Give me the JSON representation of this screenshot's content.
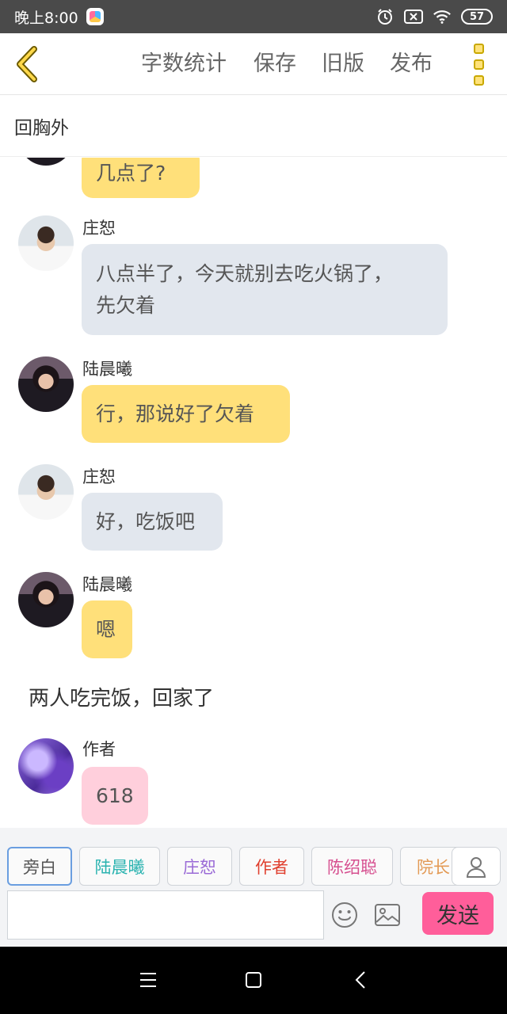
{
  "status_bar": {
    "time": "晚上8:00",
    "battery": "57"
  },
  "toolbar": {
    "word_count": "字数统计",
    "save": "保存",
    "old_version": "旧版",
    "publish": "发布"
  },
  "chapter": {
    "title": "回胸外"
  },
  "messages": [
    {
      "type": "bubble",
      "text": "几点了?",
      "color": "yellow"
    },
    {
      "type": "chat",
      "name": "庄恕",
      "avatar": "zhuang-shu-avatar",
      "color": "grey",
      "lines": [
        "八点半了，今天就别去吃火锅了，",
        "先欠着"
      ]
    },
    {
      "type": "chat",
      "name": "陆晨曦",
      "avatar": "lu-chenxi-avatar",
      "color": "yellow",
      "text": "行，那说好了欠着"
    },
    {
      "type": "chat",
      "name": "庄恕",
      "avatar": "zhuang-shu-avatar",
      "color": "grey",
      "text": "好，吃饭吧"
    },
    {
      "type": "chat",
      "name": "陆晨曦",
      "avatar": "lu-chenxi-avatar",
      "color": "yellow",
      "text": "嗯"
    },
    {
      "type": "narration",
      "text": "两人吃完饭，回家了"
    },
    {
      "type": "chat",
      "name": "作者",
      "avatar": "author-avatar",
      "color": "pink",
      "text": "618"
    }
  ],
  "characters": [
    {
      "label": "旁白",
      "color": "#555555",
      "active": true
    },
    {
      "label": "陆晨曦",
      "color": "#2bb3b0"
    },
    {
      "label": "庄恕",
      "color": "#9a6ad6"
    },
    {
      "label": "作者",
      "color": "#e0402f"
    },
    {
      "label": "陈绍聪",
      "color": "#d64f8f"
    },
    {
      "label": "院长",
      "color": "#e39a55"
    }
  ],
  "composer": {
    "input_value": "",
    "send_label": "发送"
  },
  "colors": {
    "yellow_bubble": "#ffe07a",
    "grey_bubble": "#e2e7ee",
    "pink_bubble": "#ffcfdc",
    "send_button": "#ff5e9a",
    "accent": "#c9a800"
  }
}
